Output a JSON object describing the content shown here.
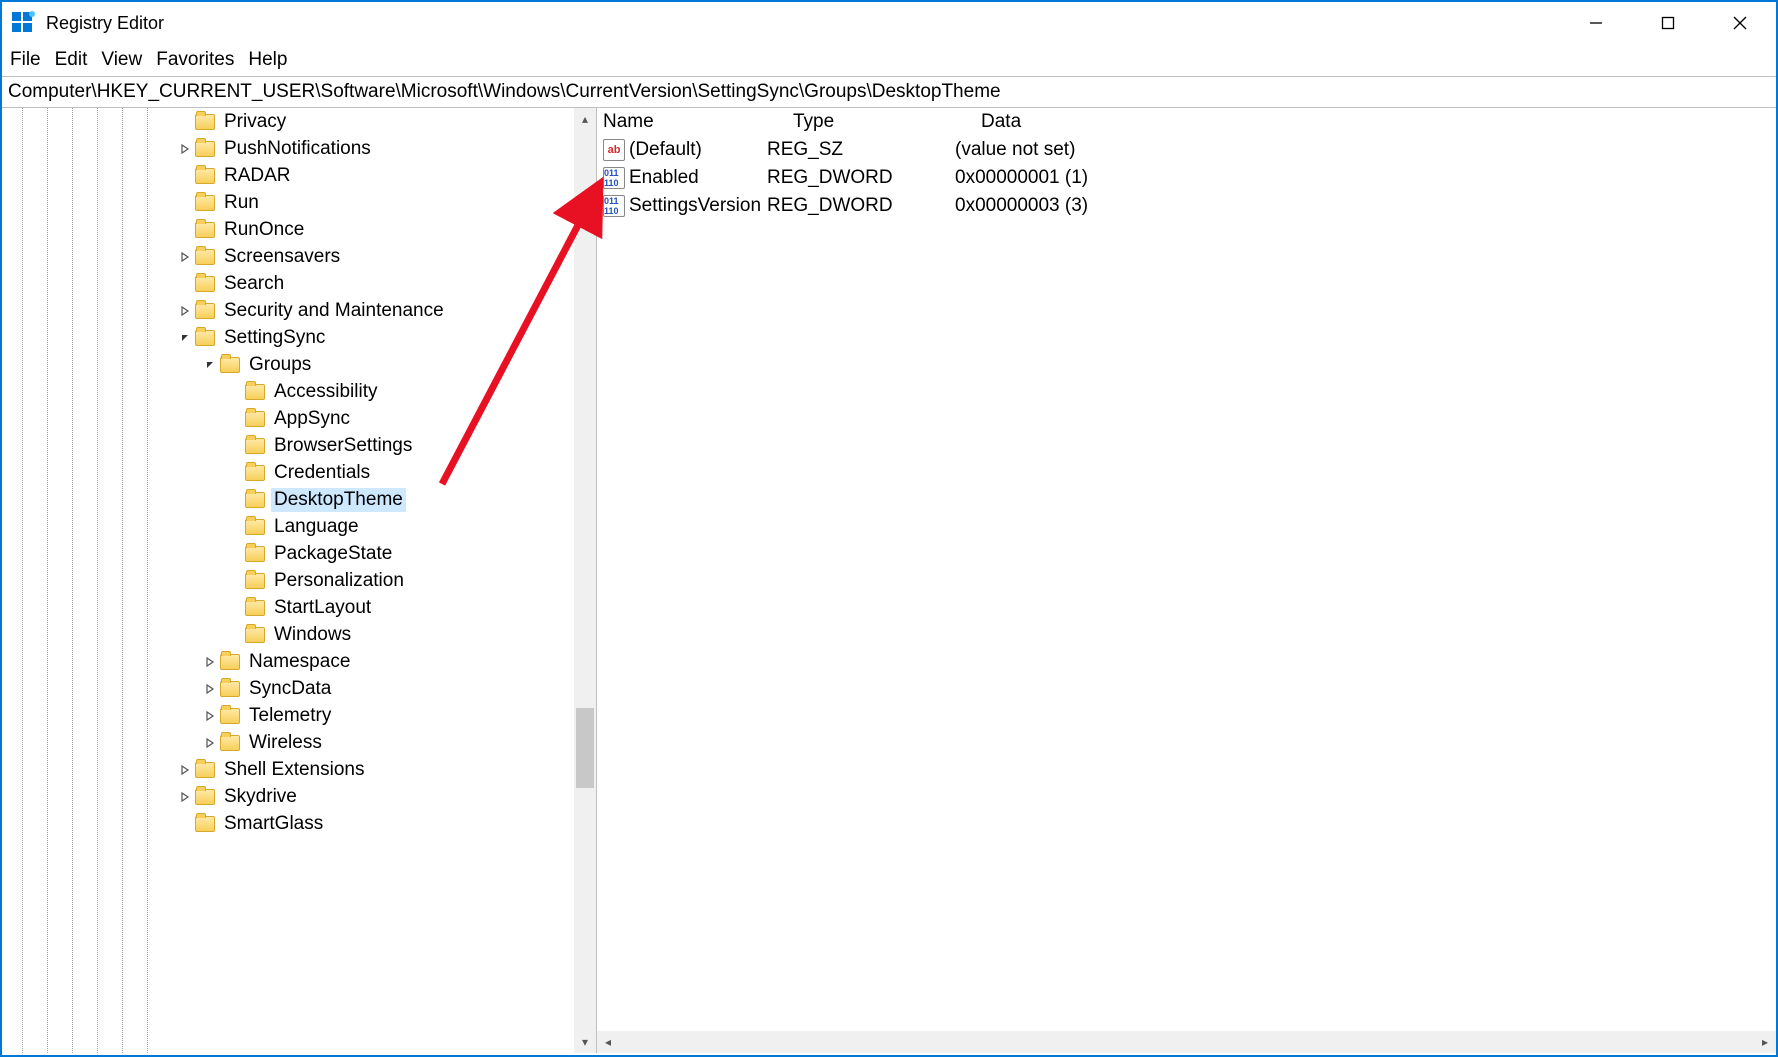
{
  "window": {
    "title": "Registry Editor"
  },
  "menubar": [
    "File",
    "Edit",
    "View",
    "Favorites",
    "Help"
  ],
  "address": "Computer\\HKEY_CURRENT_USER\\Software\\Microsoft\\Windows\\CurrentVersion\\SettingSync\\Groups\\DesktopTheme",
  "tree": [
    {
      "indent": 7,
      "expander": "",
      "label": "Privacy"
    },
    {
      "indent": 7,
      "expander": ">",
      "label": "PushNotifications"
    },
    {
      "indent": 7,
      "expander": "",
      "label": "RADAR"
    },
    {
      "indent": 7,
      "expander": "",
      "label": "Run"
    },
    {
      "indent": 7,
      "expander": "",
      "label": "RunOnce"
    },
    {
      "indent": 7,
      "expander": ">",
      "label": "Screensavers"
    },
    {
      "indent": 7,
      "expander": "",
      "label": "Search"
    },
    {
      "indent": 7,
      "expander": ">",
      "label": "Security and Maintenance"
    },
    {
      "indent": 7,
      "expander": "v",
      "label": "SettingSync"
    },
    {
      "indent": 8,
      "expander": "v",
      "label": "Groups"
    },
    {
      "indent": 9,
      "expander": "",
      "label": "Accessibility"
    },
    {
      "indent": 9,
      "expander": "",
      "label": "AppSync"
    },
    {
      "indent": 9,
      "expander": "",
      "label": "BrowserSettings"
    },
    {
      "indent": 9,
      "expander": "",
      "label": "Credentials"
    },
    {
      "indent": 9,
      "expander": "",
      "label": "DesktopTheme",
      "selected": true
    },
    {
      "indent": 9,
      "expander": "",
      "label": "Language"
    },
    {
      "indent": 9,
      "expander": "",
      "label": "PackageState"
    },
    {
      "indent": 9,
      "expander": "",
      "label": "Personalization"
    },
    {
      "indent": 9,
      "expander": "",
      "label": "StartLayout"
    },
    {
      "indent": 9,
      "expander": "",
      "label": "Windows"
    },
    {
      "indent": 8,
      "expander": ">",
      "label": "Namespace"
    },
    {
      "indent": 8,
      "expander": ">",
      "label": "SyncData"
    },
    {
      "indent": 8,
      "expander": ">",
      "label": "Telemetry"
    },
    {
      "indent": 8,
      "expander": ">",
      "label": "Wireless"
    },
    {
      "indent": 7,
      "expander": ">",
      "label": "Shell Extensions"
    },
    {
      "indent": 7,
      "expander": ">",
      "label": "Skydrive"
    },
    {
      "indent": 7,
      "expander": "",
      "label": "SmartGlass"
    }
  ],
  "columns": {
    "name": "Name",
    "type": "Type",
    "data": "Data"
  },
  "values": [
    {
      "icon": "string",
      "name": "(Default)",
      "type": "REG_SZ",
      "data": "(value not set)"
    },
    {
      "icon": "dword",
      "name": "Enabled",
      "type": "REG_DWORD",
      "data": "0x00000001 (1)"
    },
    {
      "icon": "dword",
      "name": "SettingsVersion",
      "type": "REG_DWORD",
      "data": "0x00000003 (3)"
    }
  ]
}
